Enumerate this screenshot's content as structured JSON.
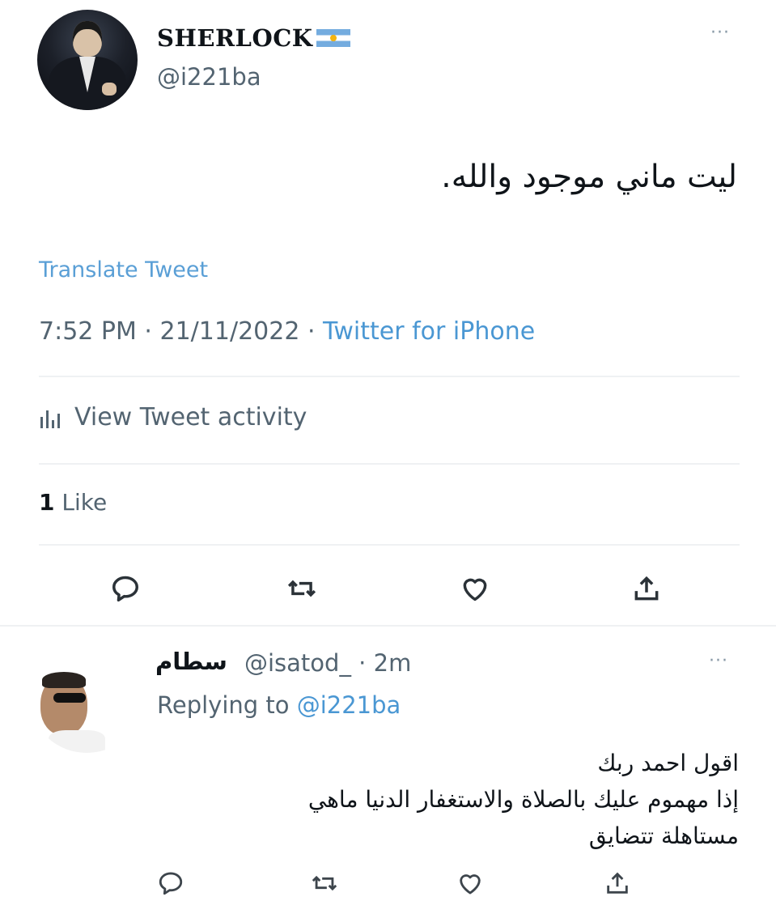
{
  "main_tweet": {
    "display_name": "SHERLOCK",
    "flag_icon": "argentina-flag-icon",
    "handle": "@i221ba",
    "text": "ليت ماني موجود والله.",
    "translate_label": "Translate Tweet",
    "time": "7:52 PM",
    "sep1": " · ",
    "date": "21/11/2022",
    "sep2": " · ",
    "source": "Twitter for iPhone",
    "activity_label": "View Tweet activity",
    "like_count": "1",
    "like_label": " Like",
    "more": "···"
  },
  "reply": {
    "display_name": "سطام",
    "handle_time": "@isatod_ · 2m",
    "replying_prefix": "Replying to ",
    "replying_to": "@i221ba",
    "text_lines": [
      "اقول احمد ربك",
      "إذا مهموم عليك بالصلاة والاستغفار الدنيا ماهي",
      "مستاهلة تتضايق"
    ],
    "more": "···"
  },
  "icons": {
    "reply": "reply-icon",
    "retweet": "retweet-icon",
    "like": "heart-icon",
    "share": "share-icon",
    "activity": "bar-chart-icon"
  },
  "colors": {
    "link": "#4a97d3",
    "secondary": "#536471",
    "divider": "#eff1f3"
  }
}
